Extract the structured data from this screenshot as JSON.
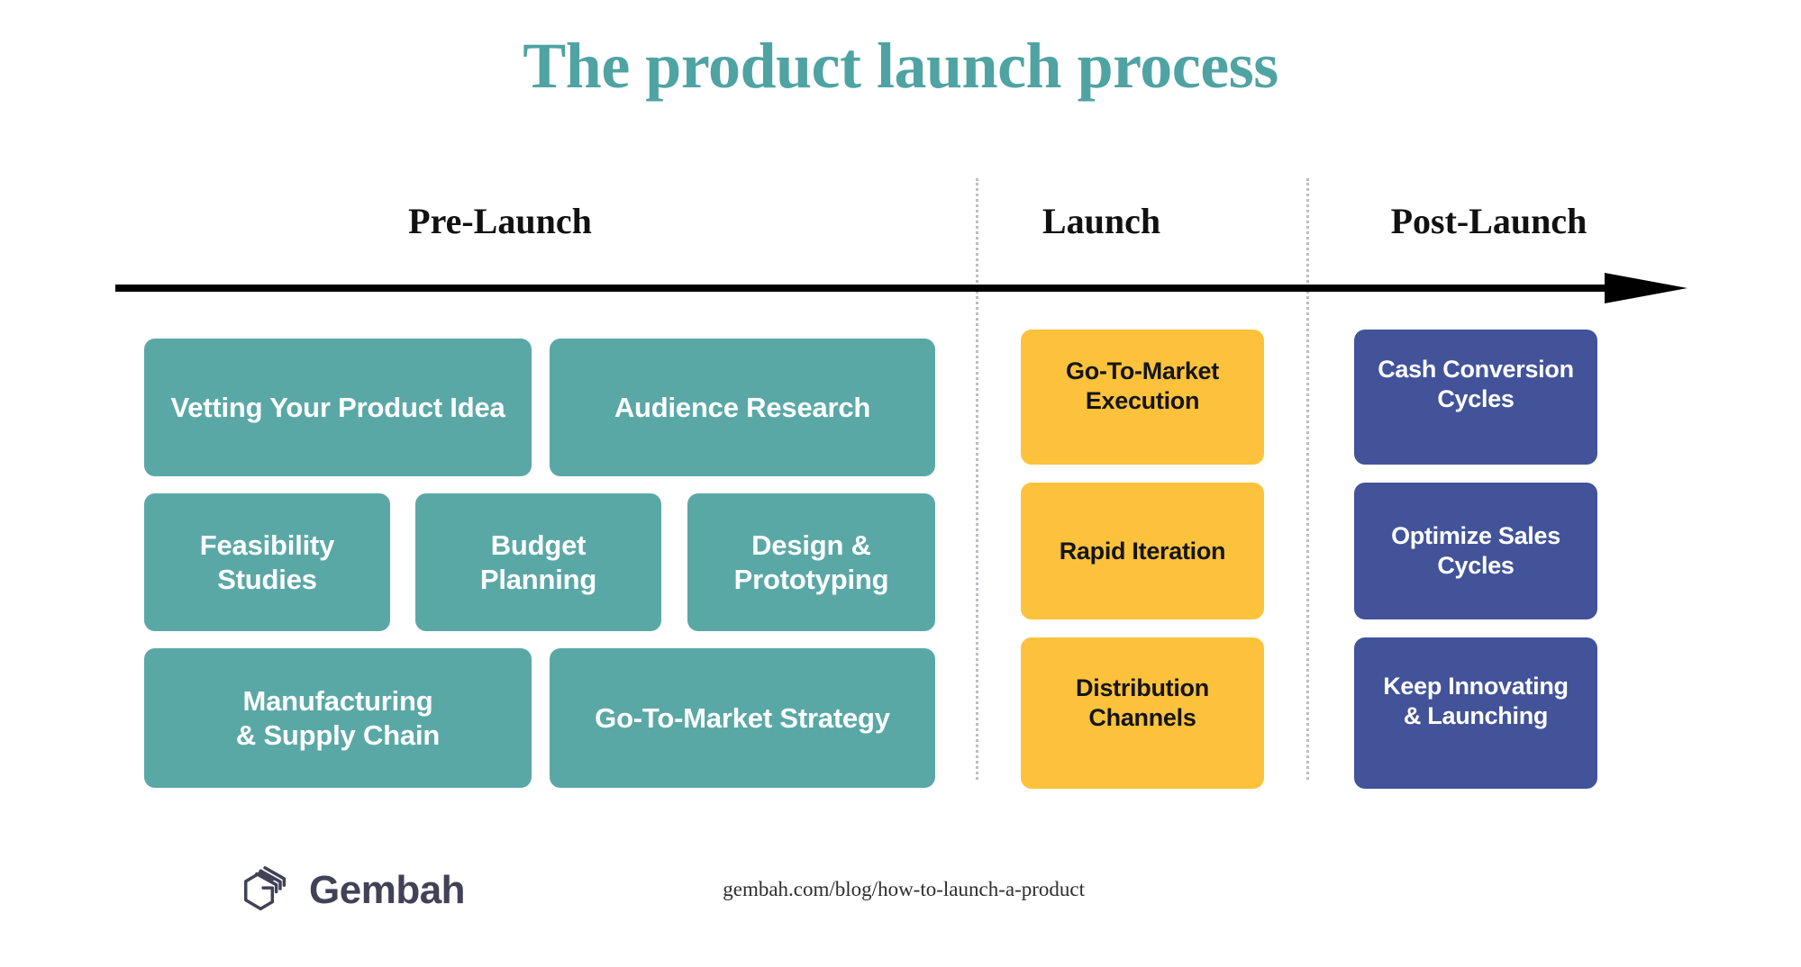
{
  "title": "The product launch process",
  "accent_color": "#4fa3a3",
  "columns": [
    {
      "id": "pre",
      "header": "Pre-Launch",
      "color": "#5aa8a6",
      "text_color": "#ffffff",
      "cards": [
        "Vetting Your Product Idea",
        "Audience Research",
        "Feasibility\nStudies",
        "Budget\nPlanning",
        "Design &\nPrototyping",
        "Manufacturing\n& Supply Chain",
        "Go-To-Market Strategy"
      ]
    },
    {
      "id": "launch",
      "header": "Launch",
      "color": "#fdc23c",
      "text_color": "#151515",
      "cards": [
        "Go-To-Market\nExecution",
        "Rapid Iteration",
        "Distribution\nChannels"
      ]
    },
    {
      "id": "post",
      "header": "Post-Launch",
      "color": "#42539a",
      "text_color": "#ffffff",
      "cards": [
        "Cash Conversion\nCycles",
        "Optimize Sales\nCycles",
        "Keep Innovating\n& Launching"
      ]
    }
  ],
  "timeline": {
    "direction": "left-to-right",
    "line_color": "#000000"
  },
  "divider_color": "#bdbdc4",
  "footer": {
    "brand": "Gembah",
    "logo_color": "#414257",
    "url": "gembah.com/blog/how-to-launch-a-product"
  },
  "chart_data": {
    "type": "table",
    "title": "The product launch process",
    "categories": [
      "Pre-Launch",
      "Launch",
      "Post-Launch"
    ],
    "series": [
      {
        "name": "Pre-Launch",
        "values": [
          "Vetting Your Product Idea",
          "Audience Research",
          "Feasibility Studies",
          "Budget Planning",
          "Design & Prototyping",
          "Manufacturing & Supply Chain",
          "Go-To-Market Strategy"
        ]
      },
      {
        "name": "Launch",
        "values": [
          "Go-To-Market Execution",
          "Rapid Iteration",
          "Distribution Channels"
        ]
      },
      {
        "name": "Post-Launch",
        "values": [
          "Cash Conversion Cycles",
          "Optimize Sales Cycles",
          "Keep Innovating & Launching"
        ]
      }
    ]
  }
}
